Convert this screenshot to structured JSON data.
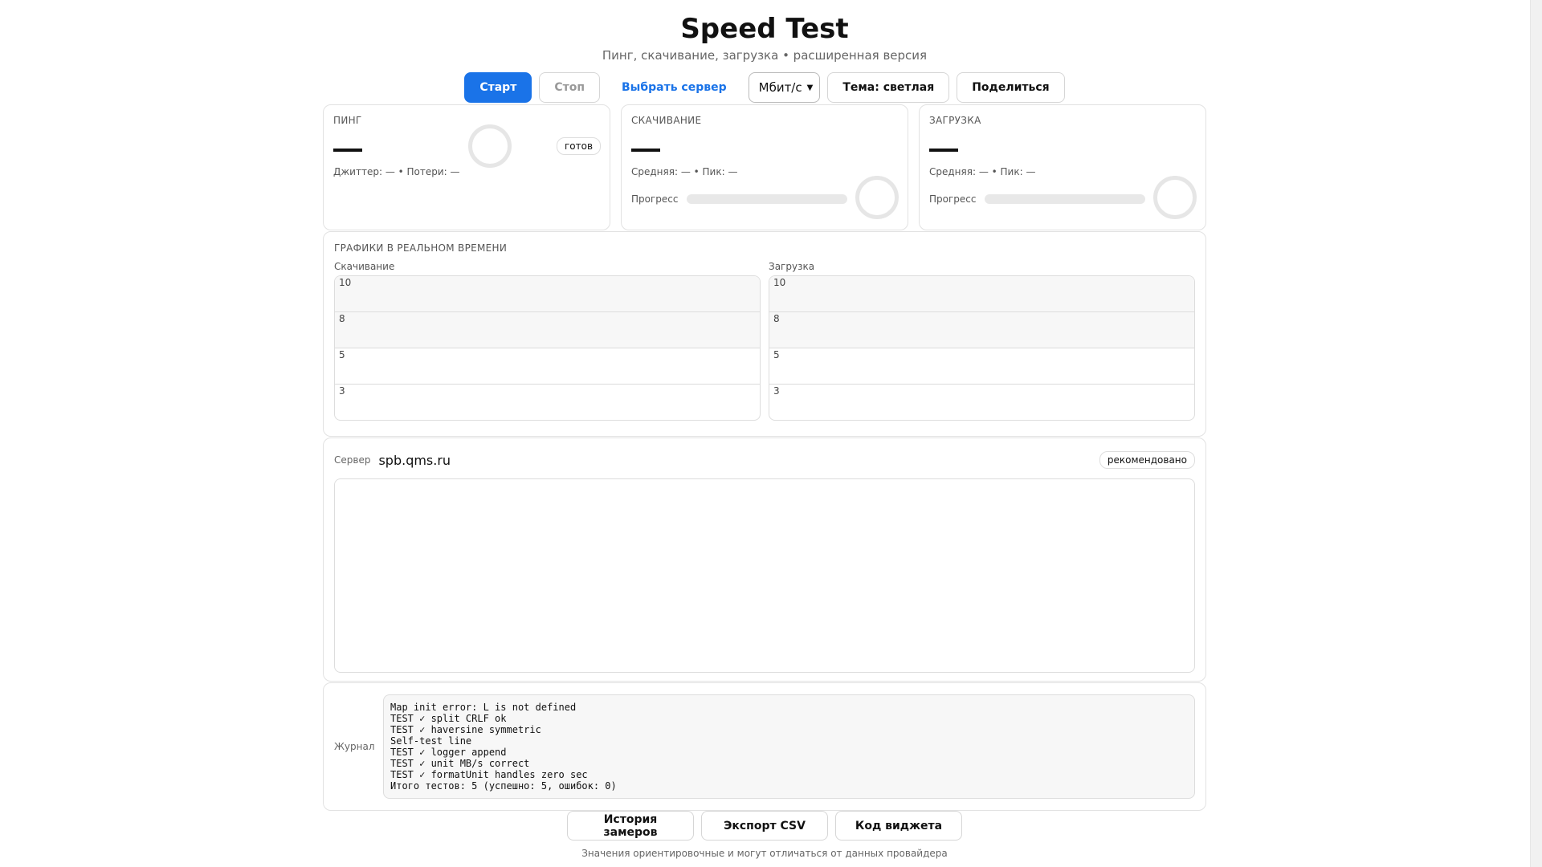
{
  "header": {
    "title": "Speed Test",
    "subtitle": "Пинг, скачивание, загрузка • расширенная версия"
  },
  "toolbar": {
    "start_label": "Старт",
    "stop_label": "Стоп",
    "server_label": "Выбрать сервер",
    "unit_selected": "Мбит/с",
    "theme_label": "Тема: светлая",
    "share_label": "Поделиться"
  },
  "ping": {
    "title": "ПИНГ",
    "stats": "Джиттер: — • Потери: —",
    "status": "готов"
  },
  "download": {
    "title": "СКАЧИВАНИЕ",
    "stats": "Средняя: — • Пик: —",
    "progress_label": "Прогресс",
    "progress": 0
  },
  "upload": {
    "title": "ЗАГРУЗКА",
    "stats": "Средняя: — • Пик: —",
    "progress_label": "Прогресс",
    "progress": 0
  },
  "graphs": {
    "title": "ГРАФИКИ В РЕАЛЬНОМ ВРЕМЕНИ",
    "download_label": "Скачивание",
    "upload_label": "Загрузка",
    "ticks": [
      "10",
      "8",
      "5",
      "3"
    ]
  },
  "server": {
    "label": "Сервер",
    "host": "spb.qms.ru",
    "recommended": "рекомендовано"
  },
  "log": {
    "label": "Журнал",
    "lines": [
      "Map init error: L is not defined",
      "TEST ✓ split CRLF ok",
      "TEST ✓ haversine symmetric",
      "Self-test line",
      "TEST ✓ logger append",
      "TEST ✓ unit MB/s correct",
      "TEST ✓ formatUnit handles zero sec",
      "Итого тестов: 5 (успешно: 5, ошибок: 0)"
    ]
  },
  "actions": {
    "history_label": "История замеров",
    "export_label": "Экспорт CSV",
    "widget_label": "Код виджета"
  },
  "footer": {
    "note": "Значения ориентировочные и могут отличаться от данных провайдера"
  },
  "colors": {
    "accent": "#1a73e8"
  }
}
